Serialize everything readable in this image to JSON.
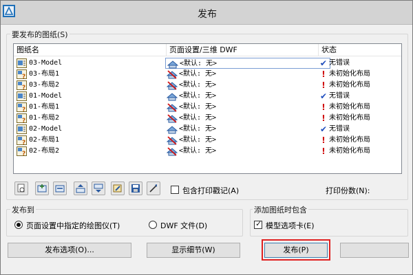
{
  "window": {
    "title": "发布"
  },
  "sheets_group": {
    "label": "要发布的图纸(S)"
  },
  "columns": {
    "name": "图纸名",
    "setup": "页面设置/三维 DWF",
    "status": "状态"
  },
  "rows": [
    {
      "name": "03-Model",
      "setup": "<默认: 无>",
      "status": "无错误",
      "status_type": "ok",
      "sheet_icon": "model-sheet-icon",
      "setup_icon": "plotter-icon",
      "selected": true
    },
    {
      "name": "03-布局1",
      "setup": "<默认: 无>",
      "status": "未初始化布局",
      "status_type": "warn",
      "sheet_icon": "layout-sheet-icon",
      "setup_icon": "plotter-crossed-icon"
    },
    {
      "name": "03-布局2",
      "setup": "<默认: 无>",
      "status": "未初始化布局",
      "status_type": "warn",
      "sheet_icon": "layout-sheet-icon",
      "setup_icon": "plotter-crossed-icon"
    },
    {
      "name": "01-Model",
      "setup": "<默认: 无>",
      "status": "无错误",
      "status_type": "ok",
      "sheet_icon": "model-sheet-icon",
      "setup_icon": "plotter-icon"
    },
    {
      "name": "01-布局1",
      "setup": "<默认: 无>",
      "status": "未初始化布局",
      "status_type": "warn",
      "sheet_icon": "layout-sheet-icon",
      "setup_icon": "plotter-crossed-icon"
    },
    {
      "name": "01-布局2",
      "setup": "<默认: 无>",
      "status": "未初始化布局",
      "status_type": "warn",
      "sheet_icon": "layout-sheet-icon",
      "setup_icon": "plotter-crossed-icon"
    },
    {
      "name": "02-Model",
      "setup": "<默认: 无>",
      "status": "无错误",
      "status_type": "ok",
      "sheet_icon": "model-sheet-icon",
      "setup_icon": "plotter-icon"
    },
    {
      "name": "02-布局1",
      "setup": "<默认: 无>",
      "status": "未初始化布局",
      "status_type": "warn",
      "sheet_icon": "layout-sheet-icon",
      "setup_icon": "plotter-crossed-icon"
    },
    {
      "name": "02-布局2",
      "setup": "<默认: 无>",
      "status": "未初始化布局",
      "status_type": "warn",
      "sheet_icon": "layout-sheet-icon",
      "setup_icon": "plotter-crossed-icon"
    }
  ],
  "toolbar": {
    "buttons": [
      "preview-icon",
      "add-sheets-icon",
      "remove-sheets-icon",
      "move-up-icon",
      "move-down-icon",
      "plot-stamp-settings-icon",
      "save-list-icon",
      "load-list-icon"
    ]
  },
  "options": {
    "plot_stamp_label": "包含打印戳记(A)",
    "plot_stamp_checked": false,
    "copies_label": "打印份数(N):"
  },
  "publish_to": {
    "label": "发布到",
    "plotter_label": "页面设置中指定的绘图仪(T)",
    "plotter_selected": true,
    "dwf_label": "DWF 文件(D)",
    "dwf_selected": false
  },
  "add_sheets": {
    "label": "添加图纸时包含",
    "model_tab_label": "模型选项卡(E)",
    "model_tab_checked": true
  },
  "buttons": {
    "publish_options": "发布选项(O)...",
    "show_details": "显示细节(W)",
    "publish": "发布(P)"
  },
  "colors": {
    "highlight": "#e02020",
    "check": "#1f4fbf",
    "warning": "#d01010"
  }
}
